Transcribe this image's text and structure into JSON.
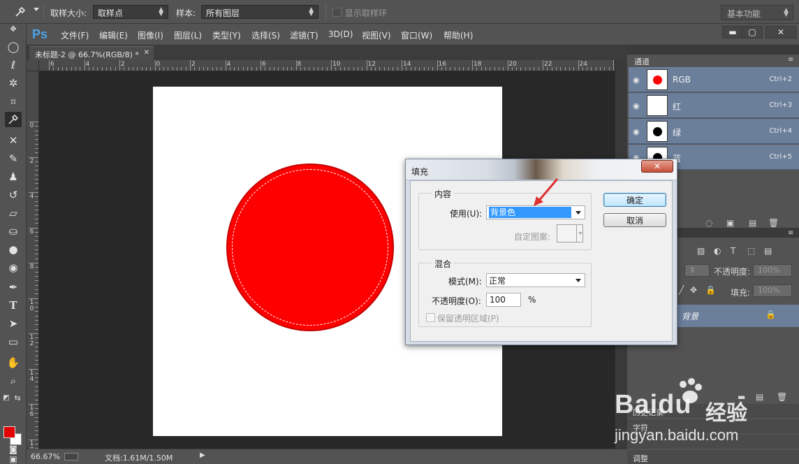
{
  "options_bar": {
    "sample_size_label": "取样大小:",
    "sample_size_value": "取样点",
    "sample_label": "样本:",
    "sample_value": "所有图层",
    "show_ring_label": "显示取样环",
    "workspace": "基本功能"
  },
  "menubar": {
    "logo": "Ps",
    "items": [
      "文件(F)",
      "编辑(E)",
      "图像(I)",
      "图层(L)",
      "类型(Y)",
      "选择(S)",
      "滤镜(T)",
      "3D(D)",
      "视图(V)",
      "窗口(W)",
      "帮助(H)"
    ],
    "window_buttons": [
      "▬",
      "▢",
      "✕"
    ]
  },
  "document": {
    "tab_title": "未标题-2 @ 66.7%(RGB/8) *",
    "tab_close": "✕",
    "ruler_top_labels": [
      "6",
      "4",
      "2",
      "0",
      "2",
      "4",
      "6",
      "8",
      "10",
      "12",
      "14",
      "16",
      "18",
      "20",
      "22",
      "24",
      "2"
    ],
    "ruler_left_labels": [
      "0",
      "2",
      "4",
      "6",
      "8",
      "10",
      "12",
      "14",
      "16",
      "18"
    ]
  },
  "status": {
    "zoom": "66.67%",
    "doc_size": "文档:1.61M/1.50M",
    "arrow": "▶"
  },
  "channels_panel": {
    "tab": "通道",
    "channels": [
      {
        "name": "RGB",
        "shortcut": "Ctrl+2",
        "dot_color": "#ff0000"
      },
      {
        "name": "红",
        "shortcut": "Ctrl+3",
        "dot_color": ""
      },
      {
        "name": "绿",
        "shortcut": "Ctrl+4",
        "dot_color": "#000000"
      },
      {
        "name": "蓝",
        "shortcut": "Ctrl+5",
        "dot_color": "#000000"
      }
    ]
  },
  "layers_panel": {
    "opacity_label": "不透明度:",
    "opacity_value": "100%",
    "fill_label": "填充:",
    "fill_value": "100%",
    "layer_name": "背景"
  },
  "bottom_panels": {
    "char_tab": "字符",
    "adjust_tab": "调整",
    "history_tab": "历史记录"
  },
  "fill_dialog": {
    "title": "填充",
    "close": "✕",
    "contents_group": "内容",
    "use_label": "使用(U):",
    "use_value": "背景色",
    "custom_pattern_label": "自定图案:",
    "blending_group": "混合",
    "mode_label": "模式(M):",
    "mode_value": "正常",
    "opacity_label": "不透明度(O):",
    "opacity_value": "100",
    "opacity_unit": "%",
    "preserve_label": "保留透明区域(P)",
    "ok_label": "确定",
    "cancel_label": "取消"
  },
  "watermark": {
    "brand": "Bai",
    "brand_suffix": "du",
    "cn": "经验",
    "url": "jingyan.baidu.com"
  },
  "colors": {
    "foreground": "#e30000",
    "background": "#ffffff",
    "accent": "#4aa3e8",
    "selection_highlight": "#3399ff",
    "annotation": "#e03030"
  }
}
